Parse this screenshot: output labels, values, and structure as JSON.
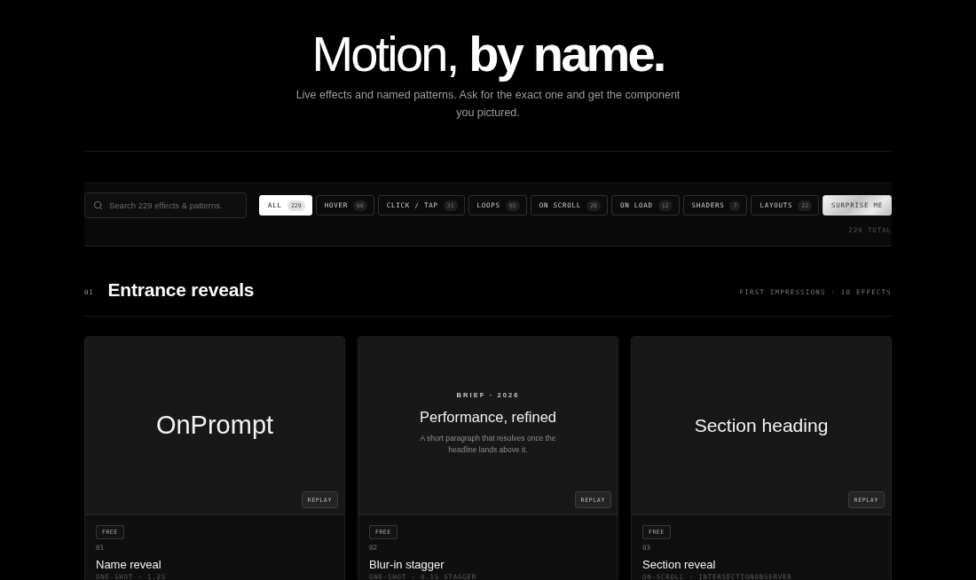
{
  "hero": {
    "title": "Motion, **by name.**",
    "subtitle": "Live effects and named patterns. Ask for the exact one and get the component you pictured."
  },
  "toolbar": {
    "search": {
      "placeholder": "Search 229 effects & patterns."
    },
    "filters": [
      {
        "label": "ALL",
        "count": "229",
        "selected": true
      },
      {
        "label": "HOVER",
        "count": "66",
        "selected": false
      },
      {
        "label": "CLICK / TAP",
        "count": "31",
        "selected": false
      },
      {
        "label": "LOOPS",
        "count": "65",
        "selected": false
      },
      {
        "label": "ON SCROLL",
        "count": "26",
        "selected": false
      },
      {
        "label": "ON LOAD",
        "count": "12",
        "selected": false
      },
      {
        "label": "SHADERS",
        "count": "7",
        "selected": false
      },
      {
        "label": "LAYOUTS",
        "count": "22",
        "selected": false
      }
    ],
    "surprise_button": {
      "label": "SURPRISE ME"
    },
    "total": "229 TOTAL"
  },
  "section": {
    "number": "01",
    "title": "Entrance reveals",
    "meta": "FIRST IMPRESSIONS · 10 EFFECTS"
  },
  "cards": [
    {
      "preview": {
        "kind": "wordmark",
        "title": "OnPrompt"
      },
      "replay": "REPLAY",
      "badge": "FREE",
      "number": "01",
      "name": "Name reveal",
      "meta": "ONE-SHOT · 1.2S"
    },
    {
      "preview": {
        "kind": "brief",
        "eyebrow": "BRIEF · 2026",
        "title": "Performance, refined",
        "body": "A short paragraph that resolves once the headline lands above it."
      },
      "replay": "REPLAY",
      "badge": "FREE",
      "number": "02",
      "name": "Blur-in stagger",
      "meta": "ONE-SHOT · 0.1S STAGGER"
    },
    {
      "preview": {
        "kind": "heading",
        "title": "Section heading"
      },
      "replay": "REPLAY",
      "badge": "FREE",
      "number": "03",
      "name": "Section reveal",
      "meta": "ON-SCROLL · INTERSECTIONOBSERVER"
    }
  ]
}
